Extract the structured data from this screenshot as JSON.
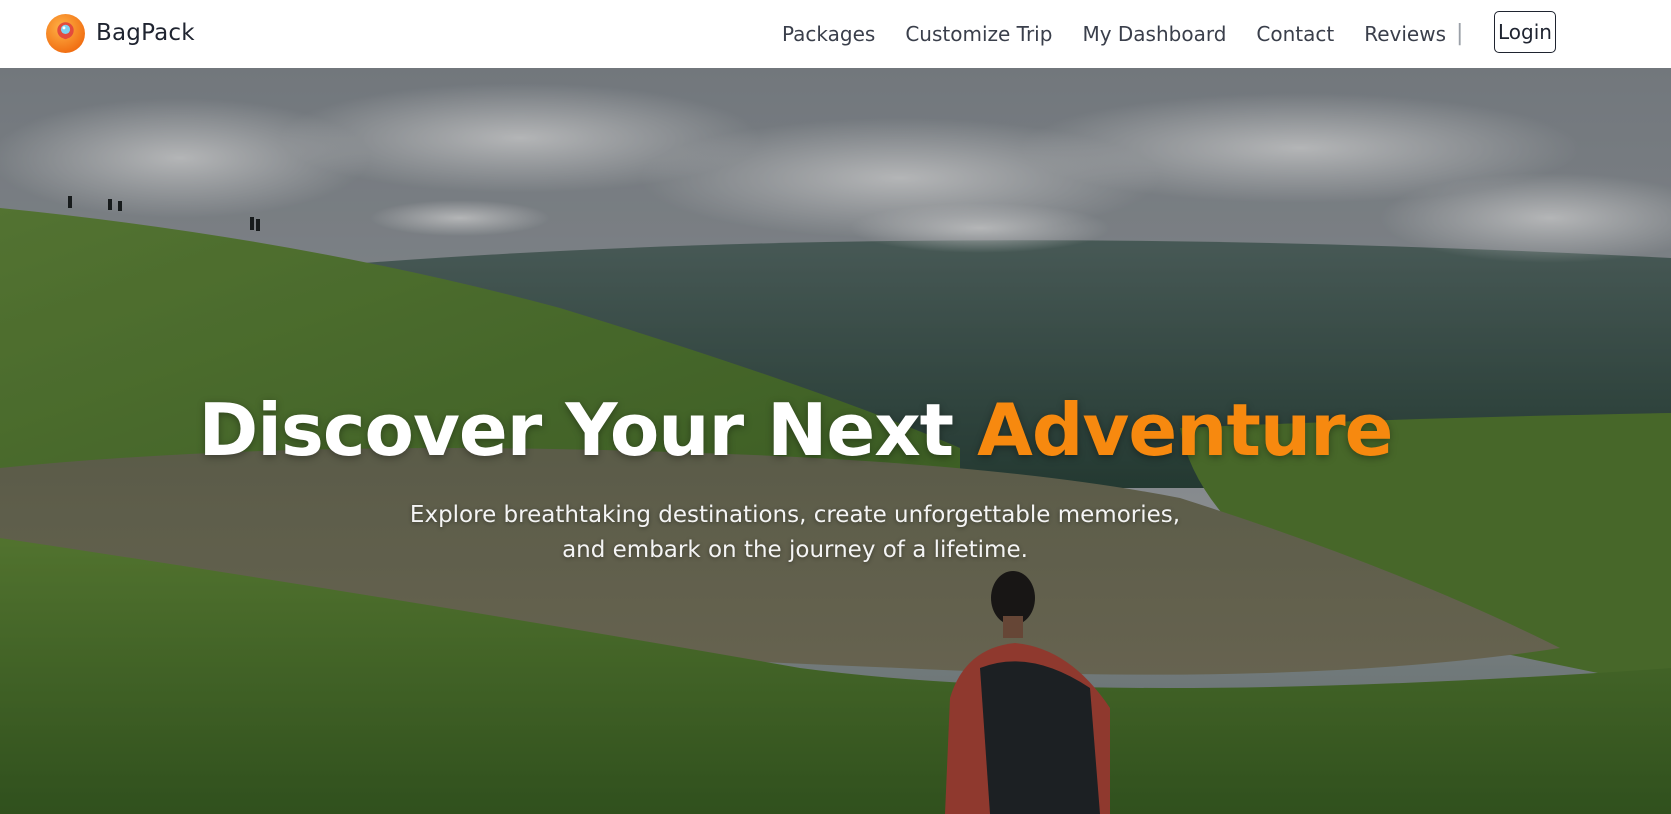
{
  "brand": {
    "name": "BagPack",
    "logo_icon": "location-pin-balloon-icon",
    "logo_color": "#f7890f"
  },
  "nav": {
    "items": [
      {
        "label": "Packages"
      },
      {
        "label": "Customize Trip"
      },
      {
        "label": "My Dashboard"
      },
      {
        "label": "Contact"
      },
      {
        "label": "Reviews"
      }
    ],
    "separator": "|",
    "login_label": "Login"
  },
  "hero": {
    "title_main": "Discover Your Next ",
    "title_accent": "Adventure",
    "accent_color": "#f7890f",
    "subtitle": "Explore breathtaking destinations, create unforgettable memories, and embark on the journey of a lifetime.",
    "background": "hiker with backpack overlooking a hilltop lake and misty valley"
  }
}
